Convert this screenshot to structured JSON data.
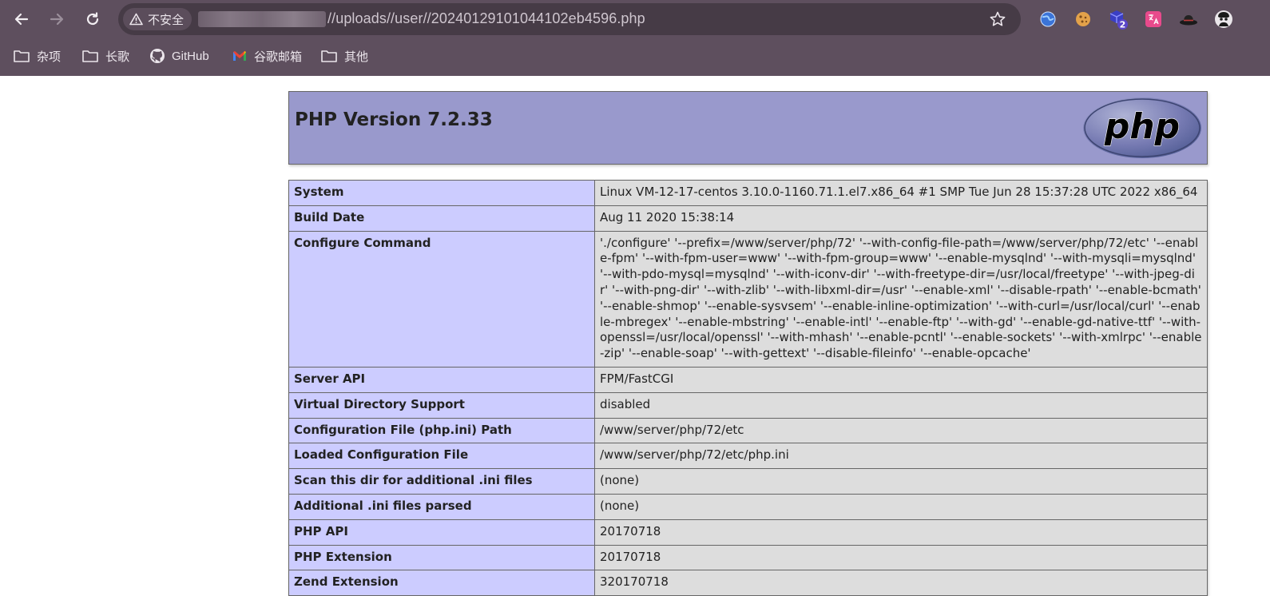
{
  "browser": {
    "security_label": "不安全",
    "url": "//uploads//user//20240129101044102eb4596.php",
    "extension_badge": "2",
    "bookmarks": [
      {
        "label": "杂项",
        "icon": "folder-icon"
      },
      {
        "label": "长歌",
        "icon": "folder-icon"
      },
      {
        "label": "GitHub",
        "icon": "github-icon"
      },
      {
        "label": "谷歌邮箱",
        "icon": "gmail-icon"
      },
      {
        "label": "其他",
        "icon": "folder-icon"
      }
    ]
  },
  "page": {
    "title": "PHP Version 7.2.33",
    "logo_text": "php",
    "header_color": "#9999cc",
    "label_cell_color": "#ccccff",
    "value_cell_color": "#dddddd",
    "rows": [
      {
        "label": "System",
        "value": "Linux VM-12-17-centos 3.10.0-1160.71.1.el7.x86_64 #1 SMP Tue Jun 28 15:37:28 UTC 2022 x86_64"
      },
      {
        "label": "Build Date",
        "value": "Aug 11 2020 15:38:14"
      },
      {
        "label": "Configure Command",
        "value": "'./configure' '--prefix=/www/server/php/72' '--with-config-file-path=/www/server/php/72/etc' '--enable-fpm' '--with-fpm-user=www' '--with-fpm-group=www' '--enable-mysqlnd' '--with-mysqli=mysqlnd' '--with-pdo-mysql=mysqlnd' '--with-iconv-dir' '--with-freetype-dir=/usr/local/freetype' '--with-jpeg-dir' '--with-png-dir' '--with-zlib' '--with-libxml-dir=/usr' '--enable-xml' '--disable-rpath' '--enable-bcmath' '--enable-shmop' '--enable-sysvsem' '--enable-inline-optimization' '--with-curl=/usr/local/curl' '--enable-mbregex' '--enable-mbstring' '--enable-intl' '--enable-ftp' '--with-gd' '--enable-gd-native-ttf' '--with-openssl=/usr/local/openssl' '--with-mhash' '--enable-pcntl' '--enable-sockets' '--with-xmlrpc' '--enable-zip' '--enable-soap' '--with-gettext' '--disable-fileinfo' '--enable-opcache'"
      },
      {
        "label": "Server API",
        "value": "FPM/FastCGI"
      },
      {
        "label": "Virtual Directory Support",
        "value": "disabled"
      },
      {
        "label": "Configuration File (php.ini) Path",
        "value": "/www/server/php/72/etc"
      },
      {
        "label": "Loaded Configuration File",
        "value": "/www/server/php/72/etc/php.ini"
      },
      {
        "label": "Scan this dir for additional .ini files",
        "value": "(none)"
      },
      {
        "label": "Additional .ini files parsed",
        "value": "(none)"
      },
      {
        "label": "PHP API",
        "value": "20170718"
      },
      {
        "label": "PHP Extension",
        "value": "20170718"
      },
      {
        "label": "Zend Extension",
        "value": "320170718"
      }
    ]
  }
}
